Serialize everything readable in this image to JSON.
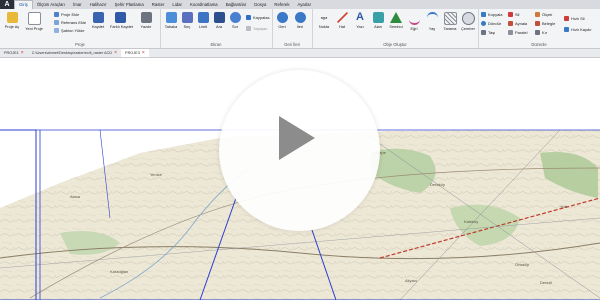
{
  "menu": {
    "logo": "A",
    "items": [
      "Giriş",
      "Ölçüm Araçları",
      "İmar",
      "Halihazır",
      "Şehir Planlama",
      "Raster",
      "Lidar",
      "Koordinatlama",
      "Bağlantılar",
      "Dosya",
      "Referek",
      "Ayarlar"
    ],
    "active_index": 0
  },
  "ribbon": {
    "groups": {
      "proje": "Proje",
      "ekran": "Ekran",
      "geri_ileri": "Geri İleri",
      "obje_olustur": "Obje Oluştur",
      "duzenle": "Düzenle"
    },
    "proje": {
      "proje_ac": "Proje Aç",
      "yeni_proje": "Yeni Proje",
      "proje_ekle": "Proje Ekle",
      "referans_ekle": "Referans Ekle",
      "sablon_yukle": "Şablon Yükle",
      "kaydet": "Kaydet",
      "farkli_kaydet": "Farklı Kaydet",
      "yazdir": "Yazdır"
    },
    "ekran": {
      "tabaka": "Tabaka",
      "sec": "Seç",
      "limit": "Limit",
      "ara": "Ara",
      "sor": "Sor",
      "kaypalas": "Kaypalas",
      "yapisan": "Yapışan"
    },
    "geri_ileri": {
      "geri": "Geri",
      "ileri": "İleri"
    },
    "obje": {
      "nokta": "Nokta",
      "hat": "Hat",
      "yazi": "Yazı",
      "alan": "Alan",
      "sembol": "Sembol",
      "egri": "Eğri",
      "yay": "Yay",
      "tarama": "Tarama",
      "cember": "Çember",
      "nokta_code": "xyz"
    },
    "duzenle": {
      "kopyala": "Kopyala",
      "sil": "Sil",
      "olcek": "Ölçek",
      "hizli_sil": "Hızlı Sil",
      "dondur": "Döndür",
      "ayna": "Aynala",
      "belegle": "Belegle",
      "tasi": "Taşı",
      "paralel": "Paralel",
      "kir": "Kır",
      "hizli_kaydir": "Hızlı Kaydır"
    }
  },
  "tabs": [
    {
      "label": "PROJE1",
      "active": false
    },
    {
      "label": "C:\\Users\\ahmet\\Desktop\\raster\\ecili_raster ACD",
      "active": false
    },
    {
      "label": "PROJE3",
      "active": true
    }
  ],
  "map": {
    "labels": [
      "Alaca",
      "Yenice",
      "Çaltepe",
      "Dereköy",
      "Kalekoy",
      "Ortaköy",
      "Yurt",
      "Karaoğlan",
      "Denizli",
      "Akyazı"
    ]
  },
  "player": {
    "icon": "play-icon"
  }
}
